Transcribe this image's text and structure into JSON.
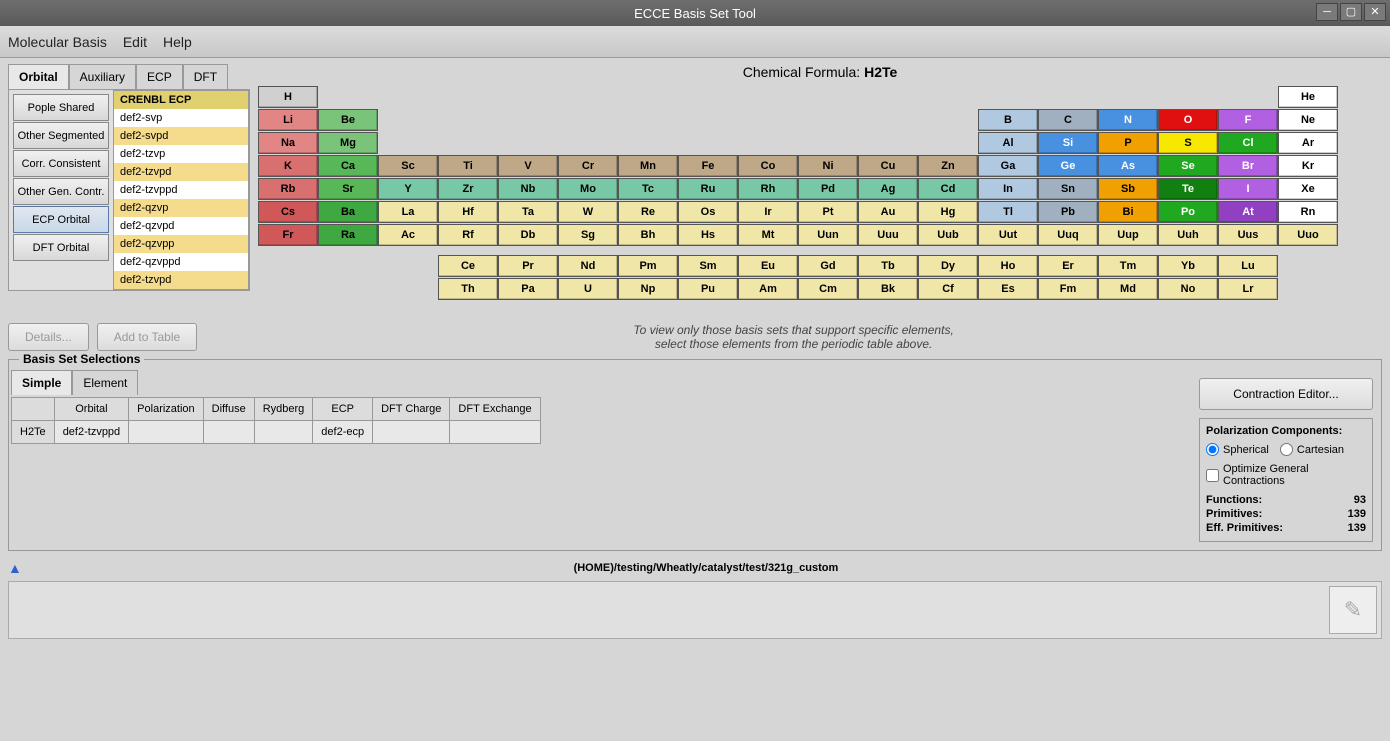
{
  "window": {
    "title": "ECCE Basis Set Tool"
  },
  "menu": {
    "items": [
      "Molecular Basis",
      "Edit",
      "Help"
    ]
  },
  "tabs": {
    "top": [
      "Orbital",
      "Auxiliary",
      "ECP",
      "DFT"
    ],
    "active": 0
  },
  "categories": [
    "Pople Shared",
    "Other Segmented",
    "Corr. Consistent",
    "Other Gen. Contr.",
    "ECP Orbital",
    "DFT Orbital"
  ],
  "categories_selected": 4,
  "basis_sets": [
    "CRENBL ECP",
    "def2-svp",
    "def2-svpd",
    "def2-tzvp",
    "def2-tzvpd",
    "def2-tzvppd",
    "def2-qzvp",
    "def2-qzvpd",
    "def2-qzvpp",
    "def2-qzvppd",
    "def2-tzvpd"
  ],
  "basis_selected": 0,
  "formula": {
    "label": "Chemical Formula:",
    "value": "H2Te"
  },
  "periodic_table": {
    "row1": [
      "H",
      "",
      "",
      "",
      "",
      "",
      "",
      "",
      "",
      "",
      "",
      "",
      "",
      "",
      "",
      "",
      "",
      "He"
    ],
    "row2": [
      "Li",
      "Be",
      "",
      "",
      "",
      "",
      "",
      "",
      "",
      "",
      "",
      "",
      "B",
      "C",
      "N",
      "O",
      "F",
      "Ne"
    ],
    "row3": [
      "Na",
      "Mg",
      "",
      "",
      "",
      "",
      "",
      "",
      "",
      "",
      "",
      "",
      "Al",
      "Si",
      "P",
      "S",
      "Cl",
      "Ar"
    ],
    "row4": [
      "K",
      "Ca",
      "Sc",
      "Ti",
      "V",
      "Cr",
      "Mn",
      "Fe",
      "Co",
      "Ni",
      "Cu",
      "Zn",
      "Ga",
      "Ge",
      "As",
      "Se",
      "Br",
      "Kr"
    ],
    "row5": [
      "Rb",
      "Sr",
      "Y",
      "Zr",
      "Nb",
      "Mo",
      "Tc",
      "Ru",
      "Rh",
      "Pd",
      "Ag",
      "Cd",
      "In",
      "Sn",
      "Sb",
      "Te",
      "I",
      "Xe"
    ],
    "row6": [
      "Cs",
      "Ba",
      "La",
      "Hf",
      "Ta",
      "W",
      "Re",
      "Os",
      "Ir",
      "Pt",
      "Au",
      "Hg",
      "Tl",
      "Pb",
      "Bi",
      "Po",
      "At",
      "Rn"
    ],
    "row7": [
      "Fr",
      "Ra",
      "Ac",
      "Rf",
      "Db",
      "Sg",
      "Bh",
      "Hs",
      "Mt",
      "Uun",
      "Uuu",
      "Uub",
      "Uut",
      "Uuq",
      "Uup",
      "Uuh",
      "Uus",
      "Uuo"
    ],
    "lan": [
      "Ce",
      "Pr",
      "Nd",
      "Pm",
      "Sm",
      "Eu",
      "Gd",
      "Tb",
      "Dy",
      "Ho",
      "Er",
      "Tm",
      "Yb",
      "Lu"
    ],
    "act": [
      "Th",
      "Pa",
      "U",
      "Np",
      "Pu",
      "Am",
      "Cm",
      "Bk",
      "Cf",
      "Es",
      "Fm",
      "Md",
      "No",
      "Lr"
    ]
  },
  "buttons": {
    "details": "Details...",
    "add": "Add to Table",
    "contraction": "Contraction Editor..."
  },
  "hint": {
    "line1": "To view only those basis sets that support specific elements,",
    "line2": "select those elements from the periodic table above."
  },
  "selections": {
    "legend": "Basis Set Selections",
    "tabs": [
      "Simple",
      "Element"
    ],
    "active": 0,
    "headers": [
      "",
      "Orbital",
      "Polarization",
      "Diffuse",
      "Rydberg",
      "ECP",
      "DFT Charge",
      "DFT Exchange"
    ],
    "rows": [
      {
        "name": "H2Te",
        "orbital": "def2-tzvppd",
        "polarization": "",
        "diffuse": "",
        "rydberg": "",
        "ecp": "def2-ecp",
        "dft_charge": "",
        "dft_exchange": ""
      }
    ]
  },
  "polarization": {
    "title": "Polarization Components:",
    "options": [
      "Spherical",
      "Cartesian"
    ],
    "selected": 0,
    "optimize_label": "Optimize General Contractions",
    "optimize_checked": false
  },
  "stats": {
    "functions_label": "Functions:",
    "functions": "93",
    "primitives_label": "Primitives:",
    "primitives": "139",
    "eff_primitives_label": "Eff. Primitives:",
    "eff_primitives": "139"
  },
  "path": "(HOME)/testing/Wheatly/catalyst/test/321g_custom"
}
